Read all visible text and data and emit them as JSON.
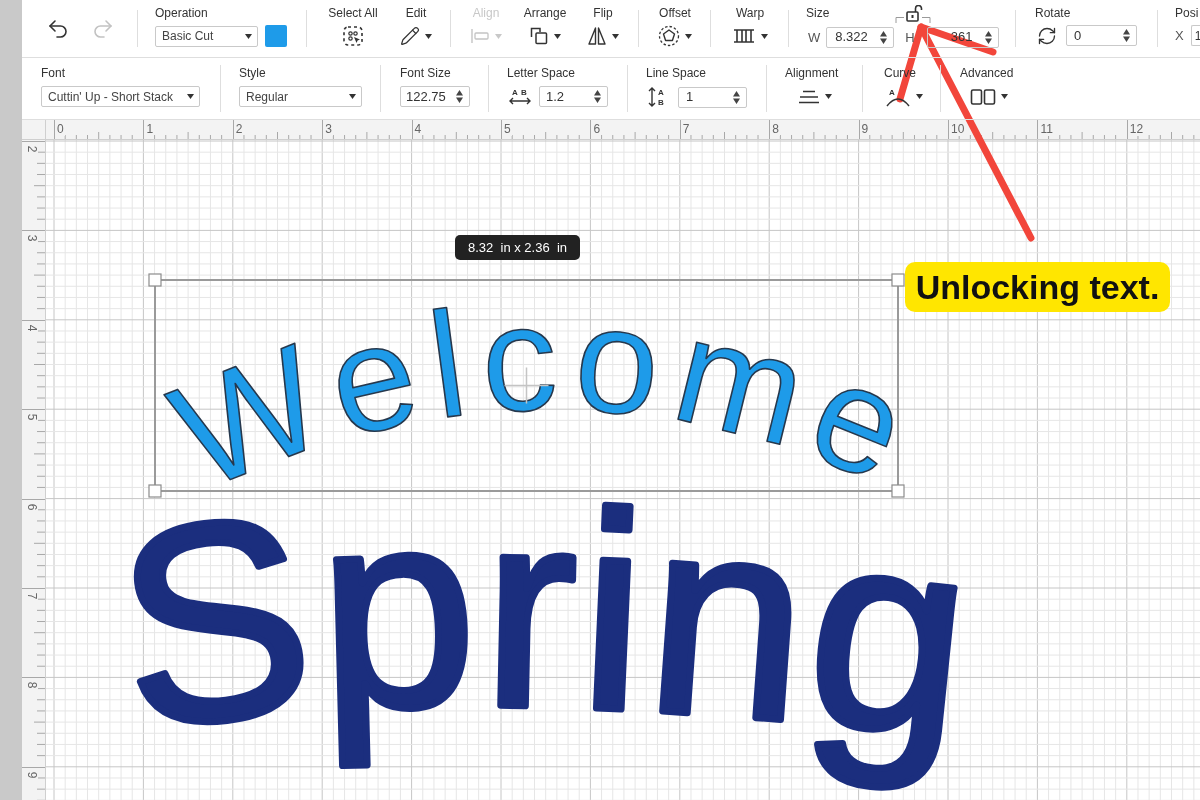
{
  "edit_toolbar": {
    "history": [
      {
        "kind": "undo",
        "disabled": false
      },
      {
        "kind": "redo",
        "disabled": true
      }
    ],
    "operation": {
      "label": "Operation",
      "value": "Basic Cut",
      "color": "#1e9be9"
    },
    "tool_groups": [
      {
        "tools": [
          {
            "kind": "select-all",
            "label": "Select All",
            "disabled": false,
            "menu": false
          },
          {
            "kind": "edit",
            "label": "Edit",
            "disabled": false,
            "menu": true
          }
        ]
      },
      {
        "tools": [
          {
            "kind": "align",
            "label": "Align",
            "disabled": true,
            "menu": true
          },
          {
            "kind": "arrange",
            "label": "Arrange",
            "disabled": false,
            "menu": true
          },
          {
            "kind": "flip",
            "label": "Flip",
            "disabled": false,
            "menu": true
          }
        ]
      },
      {
        "tools": [
          {
            "kind": "offset",
            "label": "Offset",
            "disabled": false,
            "menu": true
          }
        ]
      },
      {
        "tools": [
          {
            "kind": "warp",
            "label": "Warp",
            "disabled": false,
            "menu": true
          }
        ]
      }
    ],
    "size": {
      "label": "Size",
      "locked": false,
      "width": {
        "label": "W",
        "value": "8.322"
      },
      "height": {
        "label": "H",
        "value": "361"
      }
    },
    "rotate": {
      "label": "Rotate",
      "value": "0"
    },
    "position": {
      "label": "Posi",
      "x": {
        "label": "X",
        "value": "1"
      }
    }
  },
  "text_toolbar": {
    "font": {
      "label": "Font",
      "value": "Cuttin' Up - Short Stack"
    },
    "style": {
      "label": "Style",
      "value": "Regular"
    },
    "font_size": {
      "label": "Font Size",
      "value": "122.75"
    },
    "letter_space": {
      "label": "Letter Space",
      "icon_letters": [
        "A",
        "B"
      ],
      "value": "1.2"
    },
    "line_space": {
      "label": "Line Space",
      "icon_letters": [
        "A",
        "B"
      ],
      "value": "1"
    },
    "alignment": {
      "label": "Alignment"
    },
    "curve": {
      "label": "Curve",
      "icon_letters": [
        "A"
      ]
    },
    "advanced": {
      "label": "Advanced"
    }
  },
  "canvas": {
    "ruler_horizontal": [
      "0",
      "1",
      "2",
      "3",
      "4",
      "5",
      "6",
      "7",
      "8",
      "9",
      "10",
      "11",
      "12"
    ],
    "ruler_vertical": [
      "2",
      "3",
      "4",
      "5",
      "6",
      "7",
      "8",
      "9"
    ],
    "objects": [
      {
        "text": "Welcome",
        "color": "#1e9be9",
        "selected": true
      },
      {
        "text": "Spring",
        "color": "#1b2e7e",
        "selected": false
      }
    ],
    "size_tooltip": "8.32  in x 2.36  in"
  },
  "annotation": {
    "label": "Unlocking text."
  }
}
